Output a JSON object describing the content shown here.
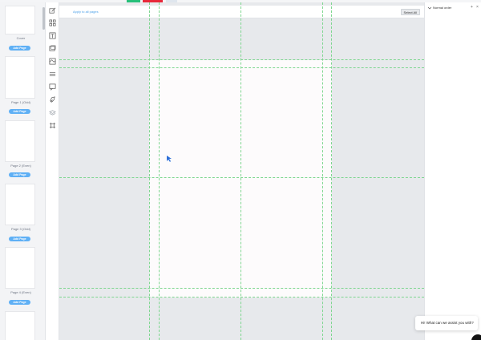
{
  "pages_panel": {
    "items": [
      {
        "label": "Cover",
        "add_label": "Add Page"
      },
      {
        "label": "Page 1 (Odd)",
        "add_label": "Add Page"
      },
      {
        "label": "Page 2 (Even)",
        "add_label": "Add Page"
      },
      {
        "label": "Page 3 (Odd)",
        "add_label": "Add Page"
      },
      {
        "label": "Page 4 (Even)",
        "add_label": ""
      }
    ]
  },
  "toolbar": {
    "tools": [
      "edit-icon",
      "components-icon",
      "text-icon",
      "image-icon",
      "background-icon",
      "lines-icon",
      "comment-icon",
      "rocket-icon",
      "layers-icon",
      "grid-icon"
    ]
  },
  "canvas": {
    "apply_link": "Apply to all pages",
    "select_all": "Select All"
  },
  "right_panel": {
    "title": "Normal order",
    "plus": "+",
    "close": "×"
  },
  "chat": {
    "message": "Hi! What can we assist you with?"
  },
  "colors": {
    "accent_green": "#27c07a",
    "accent_red": "#e8283a",
    "guide_green": "#7ed68f",
    "link_blue": "#4a9fe8"
  }
}
